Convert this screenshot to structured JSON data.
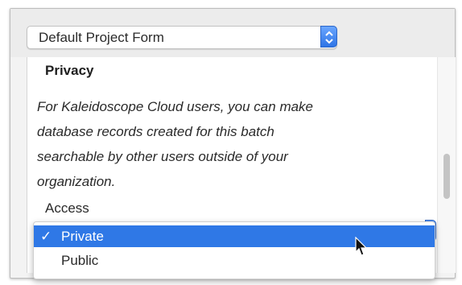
{
  "project_form": {
    "selected": "Default Project Form"
  },
  "privacy": {
    "heading": "Privacy",
    "description_lines": [
      "For Kaleidoscope Cloud users, you can make",
      "database records created for this batch",
      "searchable by other users outside of your",
      "organization."
    ],
    "access_label": "Access"
  },
  "access_menu": {
    "check_mark": "✓",
    "options": [
      {
        "label": "Private",
        "selected": true
      },
      {
        "label": "Public",
        "selected": false
      }
    ]
  },
  "colors": {
    "accent": "#2f78e6",
    "window_bg": "#f3f3f3",
    "content_bg": "#ffffff"
  },
  "icons": {
    "select_arrows": "updown-chevrons-icon",
    "pointer": "mouse-pointer-icon",
    "check": "checkmark-icon"
  }
}
